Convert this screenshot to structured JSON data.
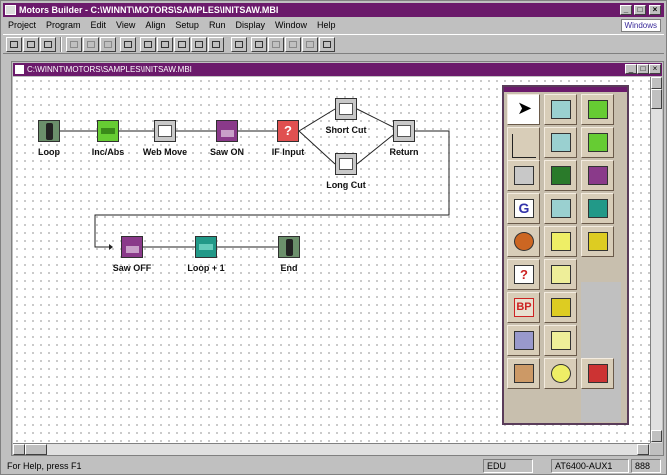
{
  "app": {
    "title": "Motors Builder - C:\\WINNT\\MOTORS\\SAMPLES\\INITSAW.MBI",
    "help_badge": "Windows"
  },
  "menu": [
    "Project",
    "Program",
    "Edit",
    "View",
    "Align",
    "Setup",
    "Run",
    "Display",
    "Window",
    "Help"
  ],
  "document": {
    "title": "C:\\WINNT\\MOTORS\\SAMPLES\\INITSAW.MBI"
  },
  "flow": {
    "nodes": [
      {
        "id": "loop",
        "label": "Loop",
        "icon": "traffic-light-icon",
        "color": "#6b8f6b"
      },
      {
        "id": "incabs",
        "label": "Inc/Abs",
        "icon": "inc-abs-icon",
        "color": "#66cc33"
      },
      {
        "id": "webmove",
        "label": "Web Move",
        "icon": "motion-icon",
        "color": "#c8c8c8"
      },
      {
        "id": "sawon",
        "label": "Saw ON",
        "icon": "output-icon",
        "color": "#8a3a8a"
      },
      {
        "id": "ifinput",
        "label": "IF Input",
        "icon": "question-icon",
        "color": "#e05050"
      },
      {
        "id": "shortcut",
        "label": "Short Cut",
        "icon": "motion-icon",
        "color": "#c8c8c8"
      },
      {
        "id": "longcut",
        "label": "Long Cut",
        "icon": "motion-icon",
        "color": "#c8c8c8"
      },
      {
        "id": "return",
        "label": "Return",
        "icon": "motion-icon",
        "color": "#c8c8c8"
      },
      {
        "id": "sawoff",
        "label": "Saw OFF",
        "icon": "output-icon",
        "color": "#8a3a8a"
      },
      {
        "id": "loopplus",
        "label": "Loop + 1",
        "icon": "variable-icon",
        "color": "#229988"
      },
      {
        "id": "end",
        "label": "End",
        "icon": "traffic-light-icon",
        "color": "#6b8f6b"
      }
    ]
  },
  "palette": {
    "tools": [
      {
        "name": "pointer-tool",
        "icon": "arrow-icon",
        "color": "#ffffff"
      },
      {
        "name": "tool-motion-1",
        "icon": "motion-icon",
        "color": "#9ad0d0"
      },
      {
        "name": "tool-set",
        "icon": "set-icon",
        "color": "#66cc33"
      },
      {
        "name": "tool-connector",
        "icon": "connector-icon",
        "color": "#d8cdb8"
      },
      {
        "name": "tool-motion-2",
        "icon": "motion-icon",
        "color": "#9ad0d0"
      },
      {
        "name": "tool-home",
        "icon": "home-icon",
        "color": "#66cc33"
      },
      {
        "name": "tool-motion-3",
        "icon": "motion-icon",
        "color": "#c8c8c8"
      },
      {
        "name": "tool-road",
        "icon": "road-icon",
        "color": "#2a7a2a"
      },
      {
        "name": "tool-output",
        "icon": "output-icon",
        "color": "#8a3a8a"
      },
      {
        "name": "tool-goto",
        "icon": "g-icon",
        "color": "#ffffff"
      },
      {
        "name": "tool-motion-4",
        "icon": "motion-icon",
        "color": "#9ad0d0"
      },
      {
        "name": "tool-variable",
        "icon": "variable-icon",
        "color": "#229988"
      },
      {
        "name": "tool-pumpkin",
        "icon": "pumpkin-icon",
        "color": "#cc6622"
      },
      {
        "name": "tool-light",
        "icon": "light-icon",
        "color": "#eeee66"
      },
      {
        "name": "tool-bulldozer",
        "icon": "bulldozer-icon",
        "color": "#ddcc22"
      },
      {
        "name": "tool-if",
        "icon": "question-icon",
        "color": "#e05050"
      },
      {
        "name": "tool-person",
        "icon": "person-icon",
        "color": "#eeee99"
      },
      {
        "name": "tool-bp",
        "icon": "bp-icon",
        "color": "#e05050"
      },
      {
        "name": "tool-page",
        "icon": "page-icon",
        "color": "#ddcc22"
      },
      {
        "name": "tool-wait",
        "icon": "wait-icon",
        "color": "#9999cc"
      },
      {
        "name": "tool-lamp",
        "icon": "lamp-icon",
        "color": "#eeee99"
      },
      {
        "name": "tool-error",
        "icon": "error-icon",
        "color": "#cc9966"
      },
      {
        "name": "tool-radiation",
        "icon": "radiation-icon",
        "color": "#eeee66"
      },
      {
        "name": "tool-stop",
        "icon": "stop-icon",
        "color": "#cc3333"
      }
    ],
    "labels": {
      "bp": "BP",
      "g": "G",
      "q": "?"
    }
  },
  "status": {
    "help": "For Help, press F1",
    "mode": "EDU",
    "addr": "AT6400-AUX1",
    "num": "888"
  }
}
